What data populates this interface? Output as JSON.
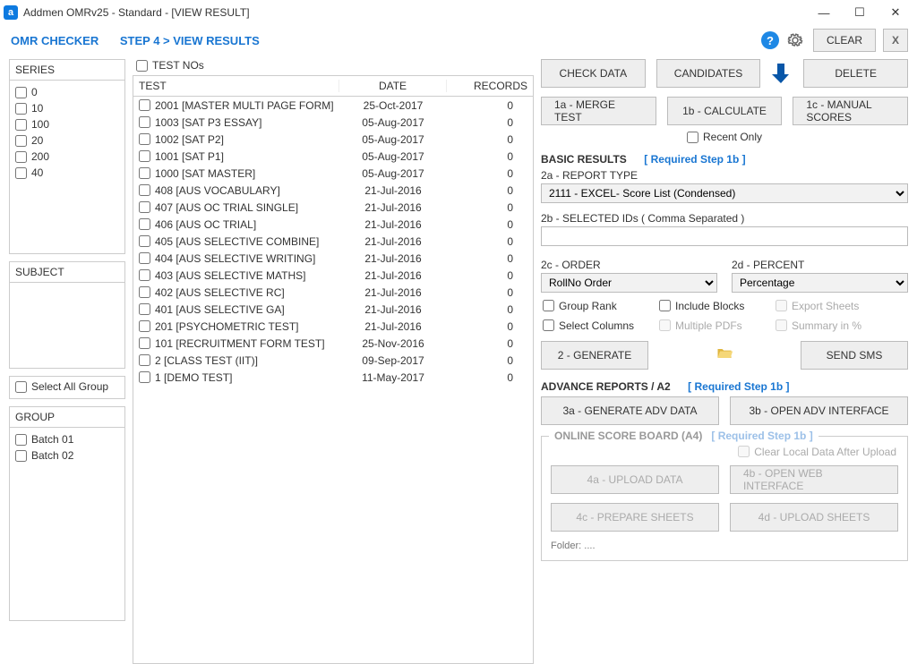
{
  "window": {
    "title": "Addmen OMRv25 - Standard - [VIEW RESULT]"
  },
  "header": {
    "module": "OMR CHECKER",
    "step": "STEP 4 > VIEW RESULTS"
  },
  "topButtons": {
    "clear": "CLEAR",
    "x": "X"
  },
  "series": {
    "label": "SERIES",
    "items": [
      "0",
      "10",
      "100",
      "20",
      "200",
      "40"
    ]
  },
  "subject": {
    "label": "SUBJECT"
  },
  "selectAllGroup": "Select All Group",
  "group": {
    "label": "GROUP",
    "items": [
      "Batch 01",
      "Batch 02"
    ]
  },
  "testNos": "TEST NOs",
  "grid": {
    "headers": {
      "test": "TEST",
      "date": "DATE",
      "records": "RECORDS"
    },
    "rows": [
      {
        "test": "2001 [MASTER MULTI PAGE FORM]",
        "date": "25-Oct-2017",
        "records": "0"
      },
      {
        "test": "1003 [SAT P3 ESSAY]",
        "date": "05-Aug-2017",
        "records": "0"
      },
      {
        "test": "1002 [SAT P2]",
        "date": "05-Aug-2017",
        "records": "0"
      },
      {
        "test": "1001 [SAT P1]",
        "date": "05-Aug-2017",
        "records": "0"
      },
      {
        "test": "1000 [SAT MASTER]",
        "date": "05-Aug-2017",
        "records": "0"
      },
      {
        "test": "408 [AUS VOCABULARY]",
        "date": "21-Jul-2016",
        "records": "0"
      },
      {
        "test": "407 [AUS OC TRIAL SINGLE]",
        "date": "21-Jul-2016",
        "records": "0"
      },
      {
        "test": "406 [AUS OC TRIAL]",
        "date": "21-Jul-2016",
        "records": "0"
      },
      {
        "test": "405 [AUS SELECTIVE COMBINE]",
        "date": "21-Jul-2016",
        "records": "0"
      },
      {
        "test": "404 [AUS SELECTIVE WRITING]",
        "date": "21-Jul-2016",
        "records": "0"
      },
      {
        "test": "403 [AUS SELECTIVE MATHS]",
        "date": "21-Jul-2016",
        "records": "0"
      },
      {
        "test": "402 [AUS SELECTIVE RC]",
        "date": "21-Jul-2016",
        "records": "0"
      },
      {
        "test": "401 [AUS SELECTIVE GA]",
        "date": "21-Jul-2016",
        "records": "0"
      },
      {
        "test": "201 [PSYCHOMETRIC  TEST]",
        "date": "21-Jul-2016",
        "records": "0"
      },
      {
        "test": "101 [RECRUITMENT FORM TEST]",
        "date": "25-Nov-2016",
        "records": "0"
      },
      {
        "test": "2 [CLASS TEST (IIT)]",
        "date": "09-Sep-2017",
        "records": "0"
      },
      {
        "test": "1 [DEMO TEST]",
        "date": "11-May-2017",
        "records": "0"
      }
    ]
  },
  "right": {
    "row1": {
      "check": "CHECK DATA",
      "cand": "CANDIDATES",
      "del": "DELETE"
    },
    "row2": {
      "merge": "1a - MERGE TEST",
      "calc": "1b - CALCULATE",
      "manual": "1c - MANUAL SCORES",
      "recent": "Recent Only"
    },
    "basic": {
      "title": "BASIC RESULTS",
      "hint": "[ Required Step 1b ]",
      "reportType": "2a - REPORT TYPE",
      "reportTypeVal": "2111 - EXCEL- Score List (Condensed)",
      "selIds": "2b - SELECTED IDs ( Comma Separated )",
      "order": "2c - ORDER",
      "orderVal": "RollNo Order",
      "percent": "2d - PERCENT",
      "percentVal": "Percentage",
      "groupRank": "Group Rank",
      "selCols": "Select Columns",
      "incBlocks": "Include Blocks",
      "multPdf": "Multiple PDFs",
      "export": "Export Sheets",
      "summary": "Summary in %",
      "generate": "2 - GENERATE",
      "sms": "SEND SMS"
    },
    "adv": {
      "title": "ADVANCE REPORTS / A2",
      "hint": "[ Required Step 1b ]",
      "gen": "3a - GENERATE ADV DATA",
      "open": "3b - OPEN ADV INTERFACE"
    },
    "osb": {
      "title": "ONLINE SCORE BOARD (A4)",
      "hint": "[ Required Step 1b ]",
      "clear": "Clear Local Data After Upload",
      "upload": "4a - UPLOAD DATA",
      "web": "4b - OPEN WEB INTERFACE",
      "prep": "4c - PREPARE SHEETS",
      "upSheets": "4d - UPLOAD SHEETS",
      "folder": "Folder: ...."
    }
  }
}
